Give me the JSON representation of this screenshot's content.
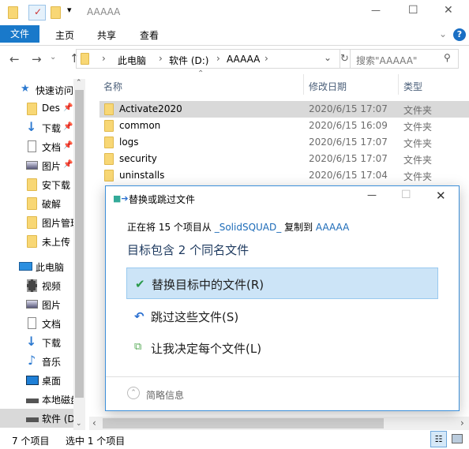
{
  "window": {
    "title": "AAAAA",
    "minimize": "—",
    "maximize": "☐",
    "close": "✕"
  },
  "ribbon": {
    "tabs": [
      "文件",
      "主页",
      "共享",
      "查看"
    ],
    "help": "?",
    "expand": "⌄"
  },
  "address": {
    "segments": [
      "此电脑",
      "软件 (D:)",
      "AAAAA"
    ],
    "search_placeholder": "搜索\"AAAAA\""
  },
  "columns": {
    "name": "名称",
    "date": "修改日期",
    "type": "类型"
  },
  "files": [
    {
      "name": "Activate2020",
      "date": "2020/6/15 17:07",
      "type": "文件夹",
      "selected": true
    },
    {
      "name": "common",
      "date": "2020/6/15 16:09",
      "type": "文件夹"
    },
    {
      "name": "logs",
      "date": "2020/6/15 17:07",
      "type": "文件夹"
    },
    {
      "name": "security",
      "date": "2020/6/15 17:07",
      "type": "文件夹"
    },
    {
      "name": "uninstalls",
      "date": "2020/6/15 17:04",
      "type": "文件夹"
    }
  ],
  "nav": {
    "quick_access": "快速访问",
    "quick": [
      "Des",
      "下载",
      "文档",
      "图片",
      "安下载",
      "破解",
      "图片管理",
      "未上传"
    ],
    "this_pc": "此电脑",
    "pc": [
      "视频",
      "图片",
      "文档",
      "下载",
      "音乐",
      "桌面",
      "本地磁盘",
      "软件 (D:)"
    ]
  },
  "status": {
    "count": "7 个项目",
    "selected": "选中 1 个项目"
  },
  "dialog": {
    "title": "替换或跳过文件",
    "line1_prefix": "正在将 15 个项目从 ",
    "source": "_SolidSQUAD_",
    "line1_mid": " 复制到 ",
    "dest": "AAAAA",
    "heading": "目标包含 2 个同名文件",
    "options": [
      "替换目标中的文件(R)",
      "跳过这些文件(S)",
      "让我决定每个文件(L)"
    ],
    "details": "简略信息"
  },
  "colors": {
    "accent": "#1979ca",
    "link": "#0066cc",
    "option_hover": "#cce4f7"
  }
}
